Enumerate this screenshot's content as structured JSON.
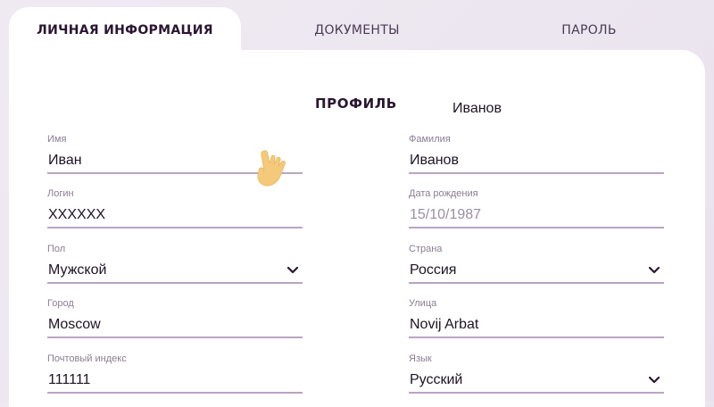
{
  "tabs": [
    {
      "label": "ЛИЧНАЯ ИНФОРМАЦИЯ",
      "active": true
    },
    {
      "label": "ДОКУМЕНТЫ",
      "active": false
    },
    {
      "label": "ПАРОЛЬ",
      "active": false
    }
  ],
  "profile": {
    "title": "ПРОФИЛЬ",
    "floating_text": "Иванов"
  },
  "fields": {
    "first_name": {
      "label": "Имя",
      "value": "Иван"
    },
    "last_name": {
      "label": "Фамилия",
      "value": "Иванов"
    },
    "login": {
      "label": "Логин",
      "value": "XXXXXX"
    },
    "birth_date": {
      "label": "Дата рождения",
      "value": "15/10/1987"
    },
    "gender": {
      "label": "Пол",
      "value": "Мужской"
    },
    "country": {
      "label": "Страна",
      "value": "Россия"
    },
    "city": {
      "label": "Город",
      "value": "Moscow"
    },
    "street": {
      "label": "Улица",
      "value": "Novij Arbat"
    },
    "postal_code": {
      "label": "Почтовый индекс",
      "value": "111111"
    },
    "language": {
      "label": "Язык",
      "value": "Русский"
    }
  },
  "icons": {
    "dropdown": "chevron-down-icon",
    "cursor": "hand-pointer-icon"
  },
  "colors": {
    "background": "#efeaf2",
    "card": "#ffffff",
    "underline": "#b9a5c3",
    "label": "#8a7d90",
    "text": "#1d1424",
    "hand": "#f5c97a"
  }
}
